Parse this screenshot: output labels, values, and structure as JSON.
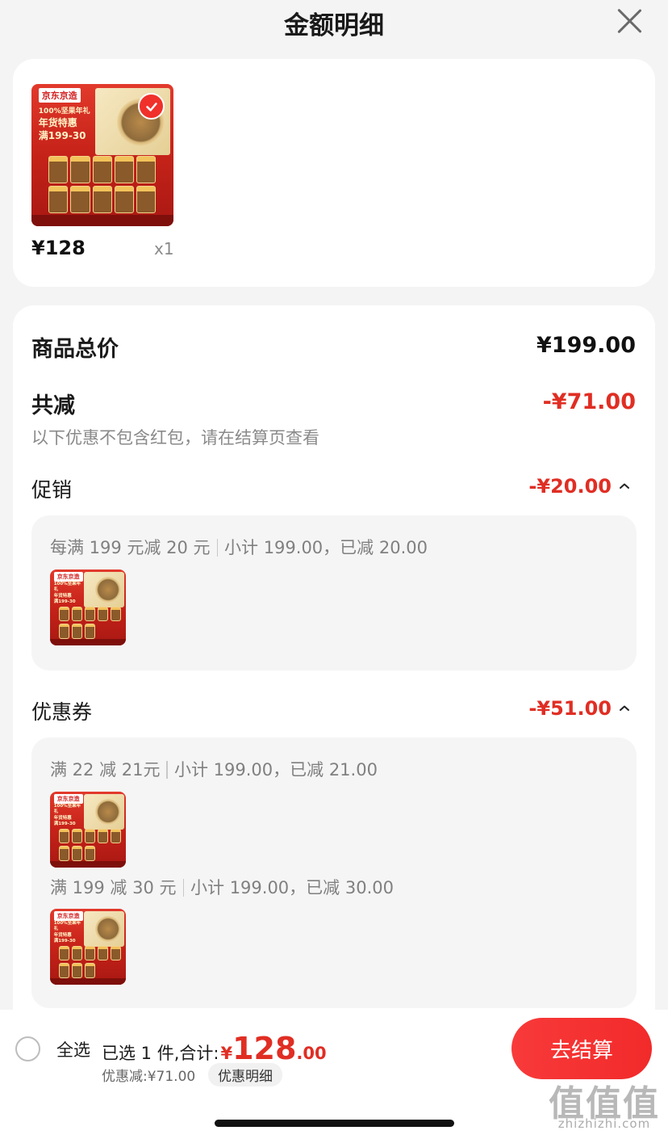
{
  "header": {
    "title": "金额明细"
  },
  "product": {
    "price": "¥128",
    "quantity": "x1",
    "image": {
      "brand": "京东京造",
      "tagline_1": "100%坚果年礼",
      "tagline_2": "年货特惠",
      "tagline_3": "满199-30"
    }
  },
  "summary": {
    "total_label": "商品总价",
    "total_value": "¥199.00",
    "discount_label": "共减",
    "discount_value": "-¥71.00",
    "note": "以下优惠不包含红包，请在结算页查看"
  },
  "promotion": {
    "label": "促销",
    "value": "-¥20.00",
    "rules": [
      {
        "rule": "每满 199 元减 20 元",
        "detail": "小计 199.00，已减 20.00"
      }
    ]
  },
  "coupon": {
    "label": "优惠券",
    "value": "-¥51.00",
    "rules": [
      {
        "rule": "满 22 减 21元",
        "detail": "小计 199.00，已减 21.00"
      },
      {
        "rule": "满 199 减 30 元",
        "detail": "小计 199.00，已减 30.00"
      }
    ]
  },
  "bottom_bar": {
    "select_all": "全选",
    "selected_text": "已选 1 件,合计:",
    "currency": "¥",
    "total_int": "128",
    "total_dec": ".00",
    "discount_text": "优惠减:¥71.00",
    "detail_chip": "优惠明细",
    "checkout": "去结算"
  },
  "watermark": {
    "main": "值值值",
    "sub": "zhizhizhi.com"
  },
  "colors": {
    "accent_red": "#e02e24",
    "checkout_red": "#f83a3a",
    "background": "#f4f4f4"
  }
}
